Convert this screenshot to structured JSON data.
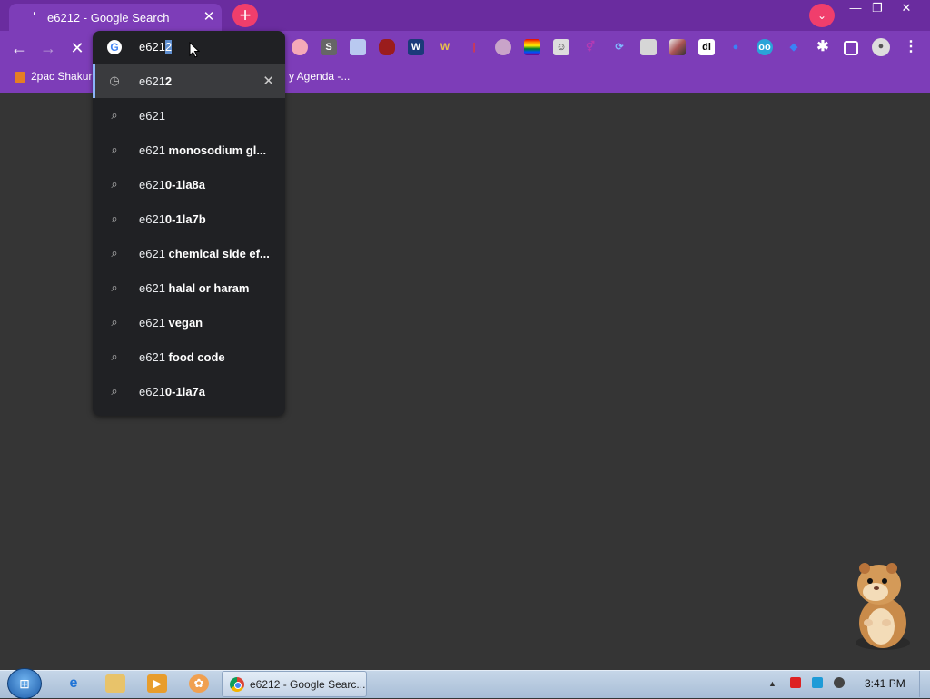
{
  "browser": {
    "tab": {
      "title": "e6212 - Google Search",
      "close": "✕"
    },
    "new_tab": "+",
    "tab_search": "⌄",
    "window": {
      "minimize": "—",
      "restore": "❐",
      "close": "✕"
    }
  },
  "toolbar": {
    "back": "←",
    "forward": "→",
    "stop": "✕",
    "extensions": "✱",
    "menu": "⋮"
  },
  "omnibox": {
    "input_typed": "e621",
    "input_selected": "2",
    "suggestions": [
      {
        "type": "history",
        "plain": "e621",
        "bold": "2",
        "remove": "✕"
      },
      {
        "type": "search",
        "plain": "e621",
        "bold": ""
      },
      {
        "type": "search",
        "plain": "e621 ",
        "bold": "monosodium gl..."
      },
      {
        "type": "search",
        "plain": "e621",
        "bold": "0-1la8a"
      },
      {
        "type": "search",
        "plain": "e621",
        "bold": "0-1la7b"
      },
      {
        "type": "search",
        "plain": "e621 ",
        "bold": "chemical side ef..."
      },
      {
        "type": "search",
        "plain": "e621 ",
        "bold": "halal or haram"
      },
      {
        "type": "search",
        "plain": "e621 ",
        "bold": "vegan"
      },
      {
        "type": "search",
        "plain": "e621 ",
        "bold": "food code"
      },
      {
        "type": "search",
        "plain": "e621",
        "bold": "0-1la7a"
      }
    ]
  },
  "bookmarks": [
    {
      "label": "2pac Shakur"
    },
    {
      "label": "y Agenda -..."
    }
  ],
  "taskbar": {
    "active_task": "e6212 - Google Searc...",
    "clock": "3:41 PM"
  },
  "colors": {
    "accent": "#7d3db8",
    "titlebar": "#6a2c9f",
    "pink": "#f03e6c"
  }
}
